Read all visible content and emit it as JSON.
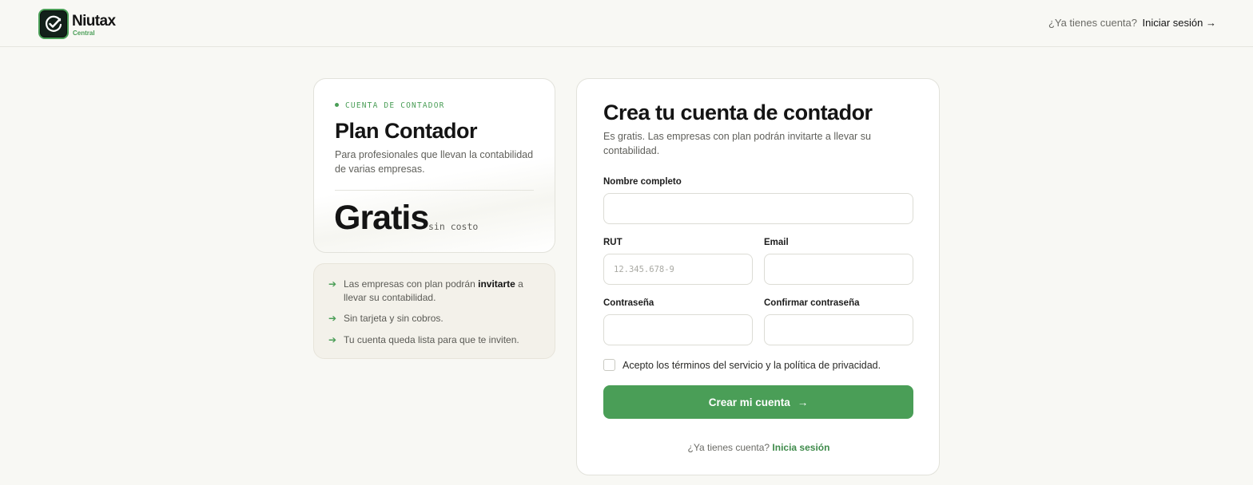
{
  "brand": {
    "name": "Niutax",
    "subtitle": "Central",
    "accent_color": "#4a9e57",
    "logo_icon": "check-circle-icon"
  },
  "header": {
    "question": "¿Ya tienes cuenta?",
    "login_link": "Iniciar sesión →"
  },
  "plan": {
    "eyebrow": "CUENTA DE CONTADOR",
    "title": "Plan Contador",
    "description": "Para profesionales que llevan la contabilidad de varias empresas.",
    "price": "Gratis",
    "price_note": "sin costo"
  },
  "benefits": {
    "icon": "arrow-right-icon",
    "items": [
      {
        "before": "Las empresas con plan podrán ",
        "bold": "invitarte",
        "after": " a llevar su contabilidad."
      },
      {
        "before": "Sin tarjeta y sin cobros.",
        "bold": "",
        "after": ""
      },
      {
        "before": "Tu cuenta queda lista para que te inviten.",
        "bold": "",
        "after": ""
      }
    ]
  },
  "form": {
    "title": "Crea tu cuenta de contador",
    "subtitle": "Es gratis. Las empresas con plan podrán invitarte a llevar su contabilidad.",
    "fields": {
      "name": {
        "label": "Nombre completo",
        "value": "",
        "placeholder": ""
      },
      "rut": {
        "label": "RUT",
        "value": "",
        "placeholder": "12.345.678-9"
      },
      "email": {
        "label": "Email",
        "value": "",
        "placeholder": ""
      },
      "password": {
        "label": "Contraseña",
        "value": "",
        "placeholder": ""
      },
      "confirm": {
        "label": "Confirmar contraseña",
        "value": "",
        "placeholder": ""
      }
    },
    "terms": "Acepto los términos del servicio y la política de privacidad.",
    "submit": "Crear mi cuenta",
    "footer_question": "¿Ya tienes cuenta?",
    "footer_link": "Inicia sesión"
  }
}
